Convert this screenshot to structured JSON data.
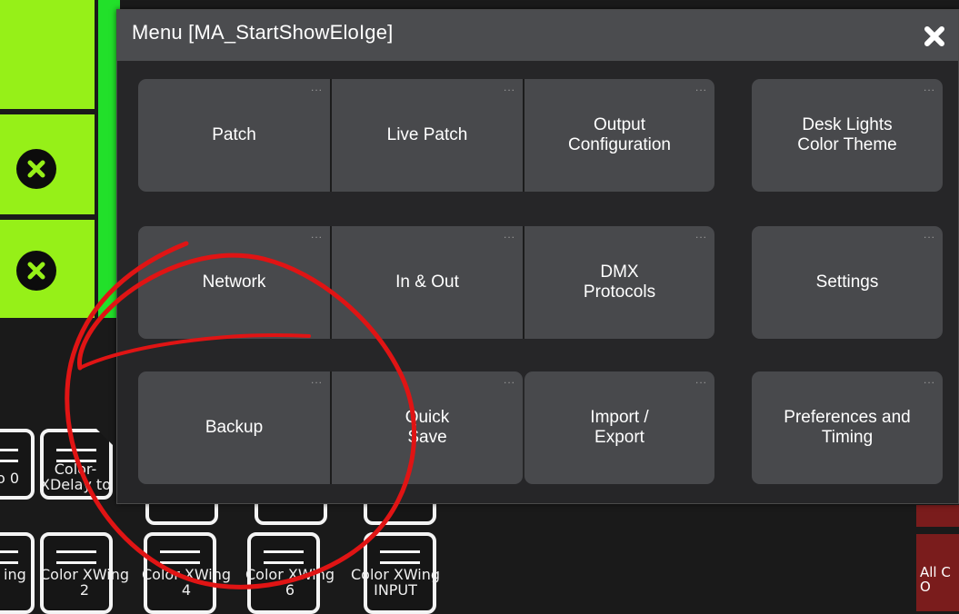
{
  "dialog": {
    "title": "Menu [MA_StartShowEloIge]",
    "close_icon": "close-icon"
  },
  "tiles": {
    "row1": [
      "Patch",
      "Live Patch",
      "Output\nConfiguration",
      "Desk Lights\nColor Theme"
    ],
    "row2": [
      "Network",
      "In & Out",
      "DMX\nProtocols",
      "Settings"
    ],
    "row3": [
      "Backup",
      "Quick\nSave",
      "Import /\nExport",
      "Preferences and\nTiming"
    ],
    "more_indicator": "..."
  },
  "background": {
    "pool_labels_top": [
      "o 0",
      "Color-\nXDelay to"
    ],
    "pool_labels_bottom": [
      "ing",
      "Color XWing\n2",
      "Color XWing\n4",
      "Color XWing\n6",
      "Color XWing\nINPUT"
    ],
    "right_button": "All C\nO"
  },
  "colors": {
    "accent_green": "#96f018",
    "bright_green": "#22e02a",
    "tile_bg": "#48494c",
    "titlebar_bg": "#4b4c4f",
    "annotation_red": "#e01414",
    "dark_red": "#7a1c1c"
  }
}
